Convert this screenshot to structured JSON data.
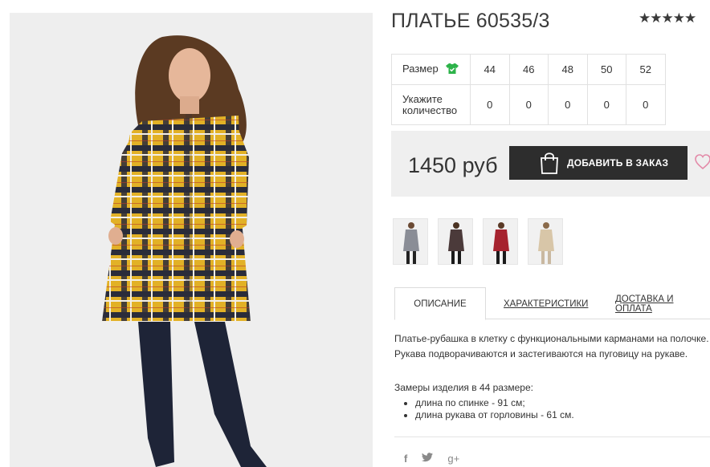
{
  "product": {
    "title": "ПЛАТЬЕ 60535/3",
    "rating_stars": "★★★★★",
    "rating_value": 5,
    "price": "1450 руб",
    "add_button_label": "ДОБАВИТЬ В ЗАКАЗ"
  },
  "sizes": {
    "row_label": "Размер",
    "quantity_label": "Укажите количество",
    "values": [
      "44",
      "46",
      "48",
      "50",
      "52"
    ],
    "quantities": [
      "0",
      "0",
      "0",
      "0",
      "0"
    ]
  },
  "thumbnails": [
    {
      "color": "grey-plaid"
    },
    {
      "color": "dark-plaid"
    },
    {
      "color": "red-plaid"
    },
    {
      "color": "beige-plaid"
    }
  ],
  "tabs": [
    {
      "label": "ОПИСАНИЕ"
    },
    {
      "label": "ХАРАКТЕРИСТИКИ"
    },
    {
      "label": "ДОСТАВКА И ОПЛАТА"
    }
  ],
  "description": {
    "line1": "Платье-рубашка в клетку с функциональными карманами на полочке.",
    "line2": "Рукава подворачиваются и застегиваются на пуговицу на рукаве.",
    "measures_title": "Замеры изделия в 44 размере:",
    "measures": [
      "длина по спинке - 91 см;",
      "длина рукава от горловины - 61 см."
    ]
  },
  "social": {
    "facebook": "f",
    "twitter": "twitter-icon",
    "googleplus": "g+"
  },
  "colors": {
    "button_bg": "#2d2d2d",
    "price_box_bg": "#efefef",
    "size_icon": "#2db34a",
    "heart": "#e38aa8"
  }
}
